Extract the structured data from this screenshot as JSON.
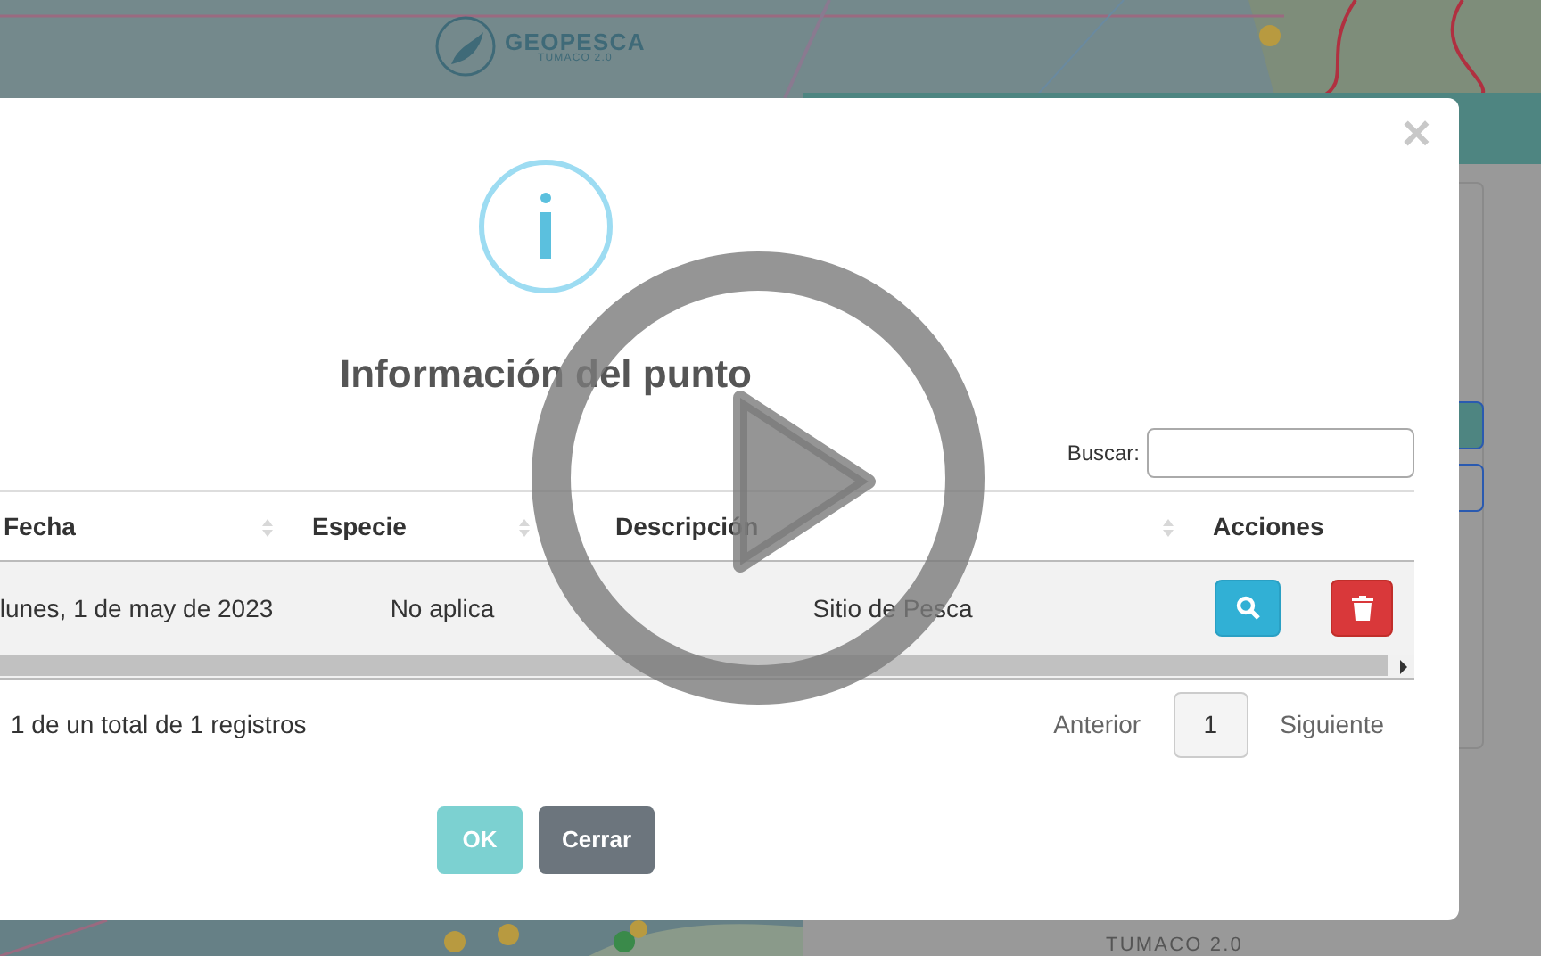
{
  "header": {
    "logo_title": "GEOPESCA",
    "logo_subtitle": "TUMACO 2.0"
  },
  "side_panel": {
    "footer_subtitle": "TUMACO 2.0"
  },
  "modal": {
    "close": "×",
    "title": "Información del punto",
    "search_label": "Buscar:",
    "table": {
      "columns": [
        {
          "label": "Fecha",
          "sortable": true
        },
        {
          "label": "Especie",
          "sortable": true
        },
        {
          "label": "Descripción",
          "sortable": true
        },
        {
          "label": "Acciones",
          "sortable": false
        }
      ],
      "rows": [
        {
          "cells": [
            "lunes, 1 de may de 2023",
            "No aplica",
            "Sitio de Pesca"
          ],
          "actions": [
            {
              "kind": "view"
            },
            {
              "kind": "delete"
            }
          ]
        }
      ]
    },
    "info": "1 de un total de 1 registros",
    "pagination": {
      "previous": "Anterior",
      "pages": [
        {
          "label": "1",
          "selected": true
        }
      ],
      "next": "Siguiente"
    },
    "buttons": [
      {
        "label": "OK",
        "kind": "primary"
      },
      {
        "label": "Cerrar",
        "kind": "secondary"
      }
    ]
  }
}
